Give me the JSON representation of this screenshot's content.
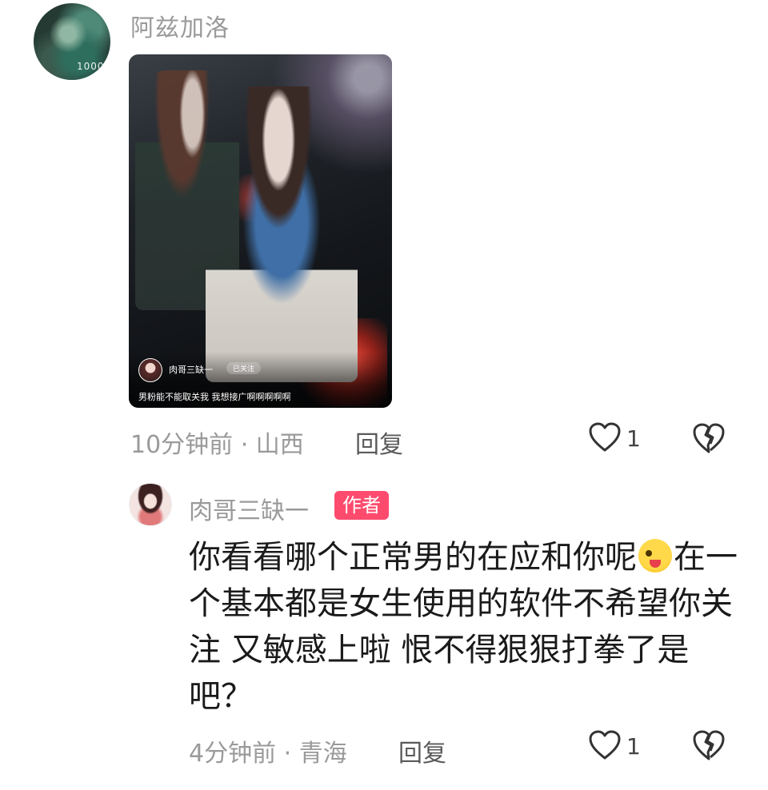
{
  "comments": [
    {
      "username": "阿兹加洛",
      "avatar_badge": "1000",
      "image_post": {
        "author": "肉哥三缺一",
        "follow_status": "已关注",
        "caption": "男粉能不能取关我 我想接广啊啊啊啊啊"
      },
      "meta": "10分钟前 · 山西",
      "reply_label": "回复",
      "likes": "1"
    },
    {
      "username": "肉哥三缺一",
      "tag": "作者",
      "text_before_emoji": "你看看哪个正常男的在应和你呢",
      "text_after_emoji": "在一个基本都是女生使用的软件不希望你关注 又敏感上啦 恨不得狠狠打拳了是吧？",
      "meta": "4分钟前 · 青海",
      "reply_label": "回复",
      "likes": "1"
    }
  ],
  "icons": {
    "like": "heart-outline-icon",
    "dislike": "broken-heart-icon"
  },
  "colors": {
    "author_tag": "#fd4b6e",
    "meta_text": "#9a9a9a"
  }
}
